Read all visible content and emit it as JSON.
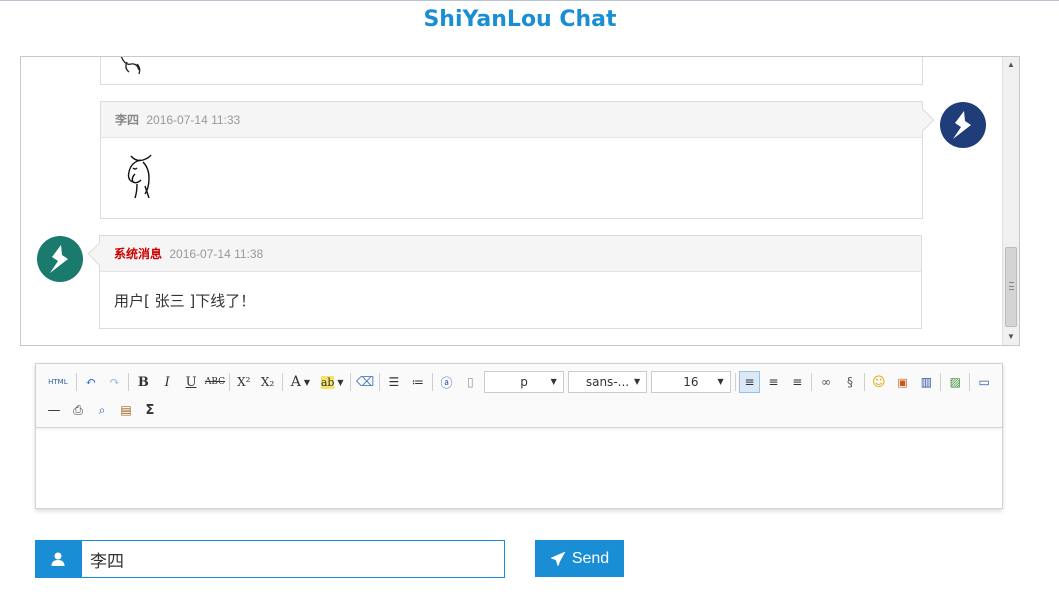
{
  "app": {
    "title": "ShiYanLou Chat"
  },
  "messages": [
    {
      "sender": "李四",
      "time": "2016-07-14 11:33",
      "content_type": "sticker",
      "side": "right",
      "avatar": "shiyanlou-logo-blue"
    },
    {
      "sender": "系统消息",
      "time": "2016-07-14 11:38",
      "text": "用户[ 张三 ]下线了！",
      "side": "left",
      "avatar": "shiyanlou-logo-teal"
    }
  ],
  "toolbar": {
    "html_label": "HTML",
    "paragraph_select": "p",
    "font_family_select": "sans-...",
    "font_size_select": "16",
    "buttons": [
      "source-html",
      "undo",
      "redo",
      "bold",
      "italic",
      "underline",
      "strikethrough",
      "superscript",
      "subscript",
      "forecolor",
      "backcolor",
      "remove-format",
      "ordered-list",
      "unordered-list",
      "anchor",
      "page",
      "justify-left",
      "justify-center",
      "justify-right",
      "link",
      "unlink",
      "emotion",
      "image",
      "video",
      "insert-image",
      "preview-screen",
      "horizontal-rule",
      "print",
      "search-preview",
      "paste",
      "formula"
    ]
  },
  "user": {
    "username": "李四"
  },
  "send": {
    "label": "Send"
  },
  "colors": {
    "accent": "#1a8ed4",
    "system_name": "#d00000"
  }
}
